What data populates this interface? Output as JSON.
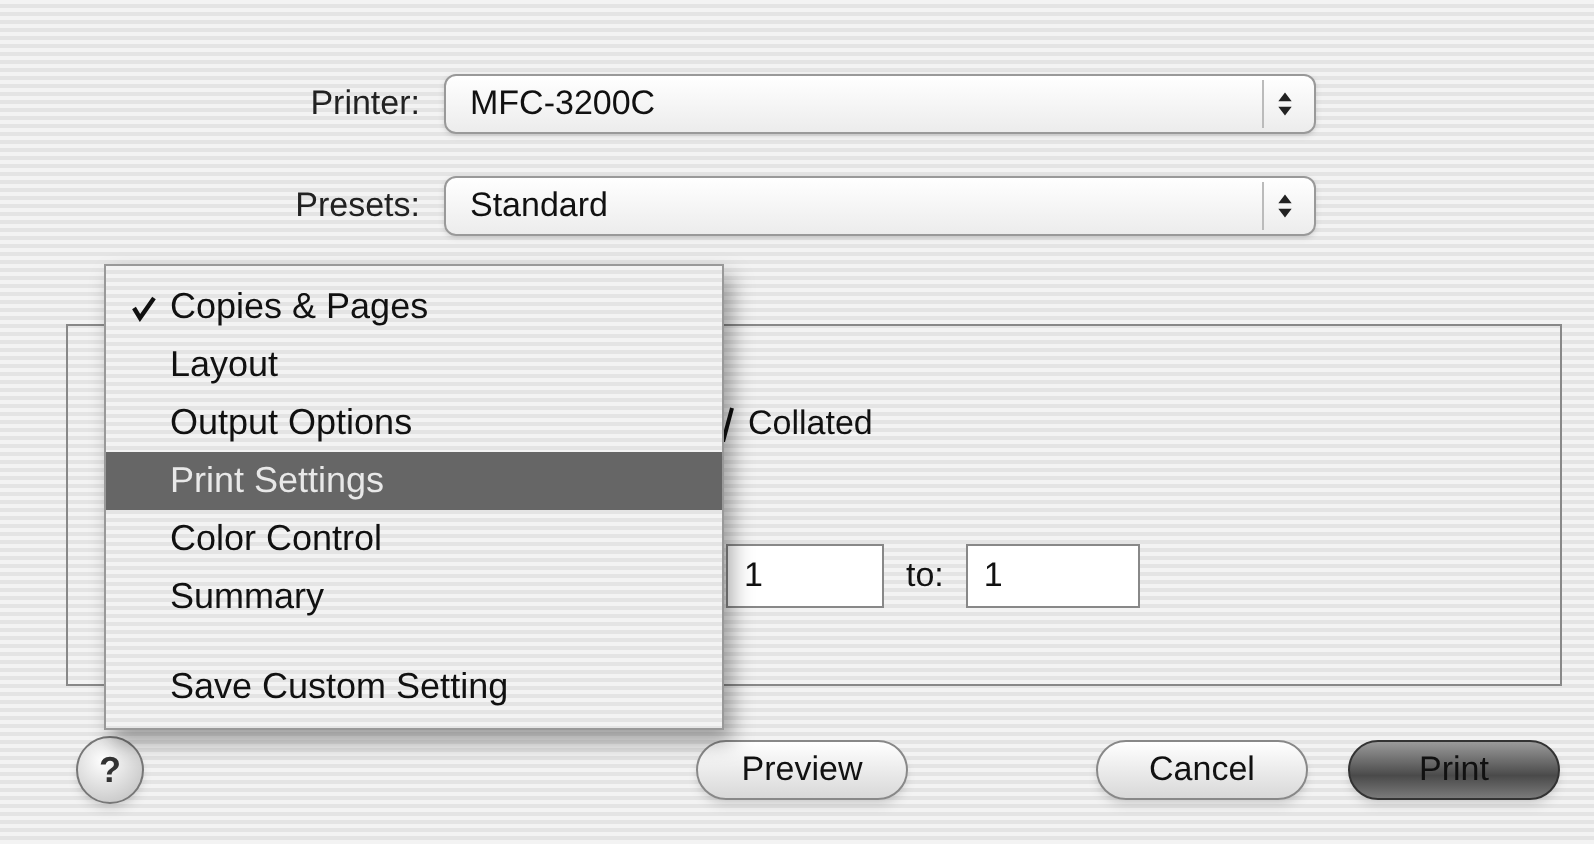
{
  "printer": {
    "label": "Printer:",
    "value": "MFC-3200C"
  },
  "presets": {
    "label": "Presets:",
    "value": "Standard"
  },
  "panel_menu": {
    "items": [
      {
        "kind": "option",
        "label": "Copies & Pages",
        "checked": true,
        "selected": false
      },
      {
        "kind": "option",
        "label": "Layout",
        "checked": false,
        "selected": false
      },
      {
        "kind": "option",
        "label": "Output Options",
        "checked": false,
        "selected": false
      },
      {
        "kind": "option",
        "label": "Print Settings",
        "checked": false,
        "selected": true
      },
      {
        "kind": "option",
        "label": "Color Control",
        "checked": false,
        "selected": false
      },
      {
        "kind": "option",
        "label": "Summary",
        "checked": false,
        "selected": false
      },
      {
        "kind": "action",
        "label": "Save Custom Setting",
        "checked": false,
        "selected": false
      }
    ]
  },
  "collated": {
    "label": "Collated",
    "checked": true
  },
  "pages": {
    "from_value": "1",
    "to_label": "to:",
    "to_value": "1"
  },
  "buttons": [
    {
      "kind": "help",
      "label": "?"
    },
    {
      "kind": "normal",
      "label": "Preview"
    },
    {
      "kind": "normal",
      "label": "Cancel"
    },
    {
      "kind": "default",
      "label": "Print"
    }
  ]
}
